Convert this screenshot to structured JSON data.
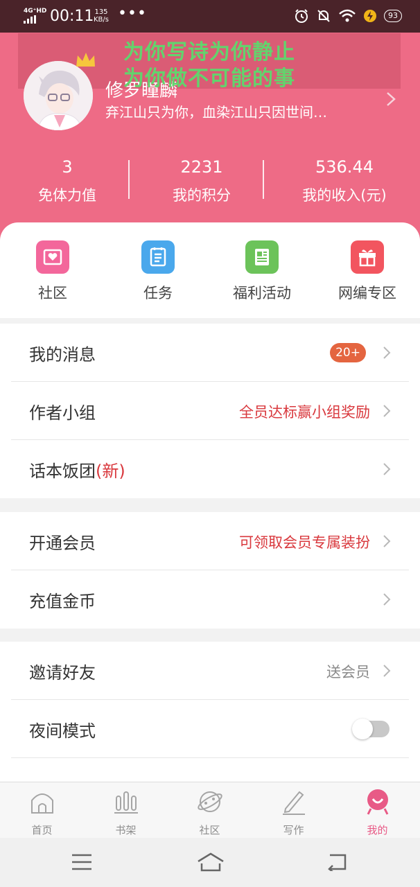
{
  "status_bar": {
    "network": "4G⁺HD",
    "time": "00:11",
    "speed_value": "135",
    "speed_unit": "KB/s",
    "more": "•••",
    "battery": "93"
  },
  "overlay": {
    "line1": "为你写诗为你静止",
    "line2": "为你做不可能的事"
  },
  "profile": {
    "name": "修罗瞳麟",
    "signature": "弃江山只为你，血染江山只因世间…"
  },
  "stats": [
    {
      "value": "3",
      "label": "免体力值"
    },
    {
      "value": "2231",
      "label": "我的积分"
    },
    {
      "value": "536.44",
      "label": "我的收入(元)"
    }
  ],
  "quick_actions": [
    {
      "label": "社区",
      "icon": "heart-envelope-icon",
      "color": "#f3679b"
    },
    {
      "label": "任务",
      "icon": "clipboard-icon",
      "color": "#4aa8ec"
    },
    {
      "label": "福利活动",
      "icon": "document-icon",
      "color": "#6cc35a"
    },
    {
      "label": "网编专区",
      "icon": "gift-icon",
      "color": "#f2555f"
    }
  ],
  "menu_group1": {
    "messages": {
      "title": "我的消息",
      "badge": "20+"
    },
    "author_group": {
      "title": "作者小组",
      "hint": "全员达标赢小组奖励"
    },
    "fan_club": {
      "title": "话本饭团",
      "tag": "(新)"
    }
  },
  "menu_group2": {
    "vip": {
      "title": "开通会员",
      "hint": "可领取会员专属装扮"
    },
    "recharge": {
      "title": "充值金币"
    }
  },
  "menu_group3": {
    "invite": {
      "title": "邀请好友",
      "hint": "送会员"
    },
    "night_mode": {
      "title": "夜间模式",
      "enabled": false
    }
  },
  "bottom_nav": [
    {
      "label": "首页",
      "icon": "home-icon"
    },
    {
      "label": "书架",
      "icon": "bookshelf-icon"
    },
    {
      "label": "社区",
      "icon": "planet-icon"
    },
    {
      "label": "写作",
      "icon": "pen-icon"
    },
    {
      "label": "我的",
      "icon": "profile-icon",
      "active": true
    }
  ],
  "colors": {
    "header_pink": "#ee6b86",
    "accent_red": "#d9383d",
    "badge_orange": "#e46540",
    "nav_active": "#e85a86",
    "overlay_green": "#63d36d"
  }
}
